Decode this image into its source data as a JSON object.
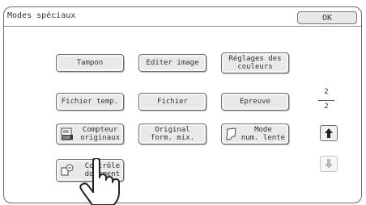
{
  "header": {
    "title": "Modes spéciaux",
    "ok_label": "OK"
  },
  "buttons": [
    {
      "label": "Tampon"
    },
    {
      "label": "Editer image"
    },
    {
      "label": "Réglages des\ncouleurs"
    },
    {
      "label": "Fichier temp."
    },
    {
      "label": "Fichier"
    },
    {
      "label": "Epreuve"
    },
    {
      "label": "Compteur\noriginaux",
      "icon": "counter-icon"
    },
    {
      "label": "Original\nform. mix."
    },
    {
      "label": "Mode\nnum. lente",
      "icon": "paper-sheet-icon"
    },
    {
      "label": "Contrôle\ndocument",
      "icon": "document-control-icon"
    }
  ],
  "pager": {
    "current": "2",
    "total": "2",
    "up_icon": "arrow-up-icon",
    "down_icon": "arrow-down-icon",
    "up_enabled": true,
    "down_enabled": false
  },
  "overlay": {
    "icon": "pointing-hand-icon"
  }
}
